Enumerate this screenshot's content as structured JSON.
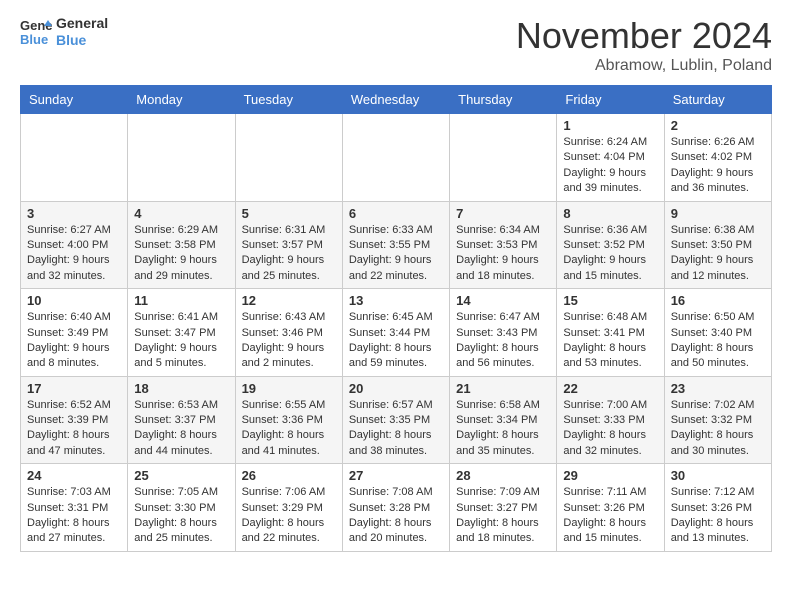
{
  "header": {
    "logo_line1": "General",
    "logo_line2": "Blue",
    "month": "November 2024",
    "location": "Abramow, Lublin, Poland"
  },
  "weekdays": [
    "Sunday",
    "Monday",
    "Tuesday",
    "Wednesday",
    "Thursday",
    "Friday",
    "Saturday"
  ],
  "weeks": [
    [
      {
        "day": "",
        "info": ""
      },
      {
        "day": "",
        "info": ""
      },
      {
        "day": "",
        "info": ""
      },
      {
        "day": "",
        "info": ""
      },
      {
        "day": "",
        "info": ""
      },
      {
        "day": "1",
        "info": "Sunrise: 6:24 AM\nSunset: 4:04 PM\nDaylight: 9 hours and 39 minutes."
      },
      {
        "day": "2",
        "info": "Sunrise: 6:26 AM\nSunset: 4:02 PM\nDaylight: 9 hours and 36 minutes."
      }
    ],
    [
      {
        "day": "3",
        "info": "Sunrise: 6:27 AM\nSunset: 4:00 PM\nDaylight: 9 hours and 32 minutes."
      },
      {
        "day": "4",
        "info": "Sunrise: 6:29 AM\nSunset: 3:58 PM\nDaylight: 9 hours and 29 minutes."
      },
      {
        "day": "5",
        "info": "Sunrise: 6:31 AM\nSunset: 3:57 PM\nDaylight: 9 hours and 25 minutes."
      },
      {
        "day": "6",
        "info": "Sunrise: 6:33 AM\nSunset: 3:55 PM\nDaylight: 9 hours and 22 minutes."
      },
      {
        "day": "7",
        "info": "Sunrise: 6:34 AM\nSunset: 3:53 PM\nDaylight: 9 hours and 18 minutes."
      },
      {
        "day": "8",
        "info": "Sunrise: 6:36 AM\nSunset: 3:52 PM\nDaylight: 9 hours and 15 minutes."
      },
      {
        "day": "9",
        "info": "Sunrise: 6:38 AM\nSunset: 3:50 PM\nDaylight: 9 hours and 12 minutes."
      }
    ],
    [
      {
        "day": "10",
        "info": "Sunrise: 6:40 AM\nSunset: 3:49 PM\nDaylight: 9 hours and 8 minutes."
      },
      {
        "day": "11",
        "info": "Sunrise: 6:41 AM\nSunset: 3:47 PM\nDaylight: 9 hours and 5 minutes."
      },
      {
        "day": "12",
        "info": "Sunrise: 6:43 AM\nSunset: 3:46 PM\nDaylight: 9 hours and 2 minutes."
      },
      {
        "day": "13",
        "info": "Sunrise: 6:45 AM\nSunset: 3:44 PM\nDaylight: 8 hours and 59 minutes."
      },
      {
        "day": "14",
        "info": "Sunrise: 6:47 AM\nSunset: 3:43 PM\nDaylight: 8 hours and 56 minutes."
      },
      {
        "day": "15",
        "info": "Sunrise: 6:48 AM\nSunset: 3:41 PM\nDaylight: 8 hours and 53 minutes."
      },
      {
        "day": "16",
        "info": "Sunrise: 6:50 AM\nSunset: 3:40 PM\nDaylight: 8 hours and 50 minutes."
      }
    ],
    [
      {
        "day": "17",
        "info": "Sunrise: 6:52 AM\nSunset: 3:39 PM\nDaylight: 8 hours and 47 minutes."
      },
      {
        "day": "18",
        "info": "Sunrise: 6:53 AM\nSunset: 3:37 PM\nDaylight: 8 hours and 44 minutes."
      },
      {
        "day": "19",
        "info": "Sunrise: 6:55 AM\nSunset: 3:36 PM\nDaylight: 8 hours and 41 minutes."
      },
      {
        "day": "20",
        "info": "Sunrise: 6:57 AM\nSunset: 3:35 PM\nDaylight: 8 hours and 38 minutes."
      },
      {
        "day": "21",
        "info": "Sunrise: 6:58 AM\nSunset: 3:34 PM\nDaylight: 8 hours and 35 minutes."
      },
      {
        "day": "22",
        "info": "Sunrise: 7:00 AM\nSunset: 3:33 PM\nDaylight: 8 hours and 32 minutes."
      },
      {
        "day": "23",
        "info": "Sunrise: 7:02 AM\nSunset: 3:32 PM\nDaylight: 8 hours and 30 minutes."
      }
    ],
    [
      {
        "day": "24",
        "info": "Sunrise: 7:03 AM\nSunset: 3:31 PM\nDaylight: 8 hours and 27 minutes."
      },
      {
        "day": "25",
        "info": "Sunrise: 7:05 AM\nSunset: 3:30 PM\nDaylight: 8 hours and 25 minutes."
      },
      {
        "day": "26",
        "info": "Sunrise: 7:06 AM\nSunset: 3:29 PM\nDaylight: 8 hours and 22 minutes."
      },
      {
        "day": "27",
        "info": "Sunrise: 7:08 AM\nSunset: 3:28 PM\nDaylight: 8 hours and 20 minutes."
      },
      {
        "day": "28",
        "info": "Sunrise: 7:09 AM\nSunset: 3:27 PM\nDaylight: 8 hours and 18 minutes."
      },
      {
        "day": "29",
        "info": "Sunrise: 7:11 AM\nSunset: 3:26 PM\nDaylight: 8 hours and 15 minutes."
      },
      {
        "day": "30",
        "info": "Sunrise: 7:12 AM\nSunset: 3:26 PM\nDaylight: 8 hours and 13 minutes."
      }
    ]
  ]
}
